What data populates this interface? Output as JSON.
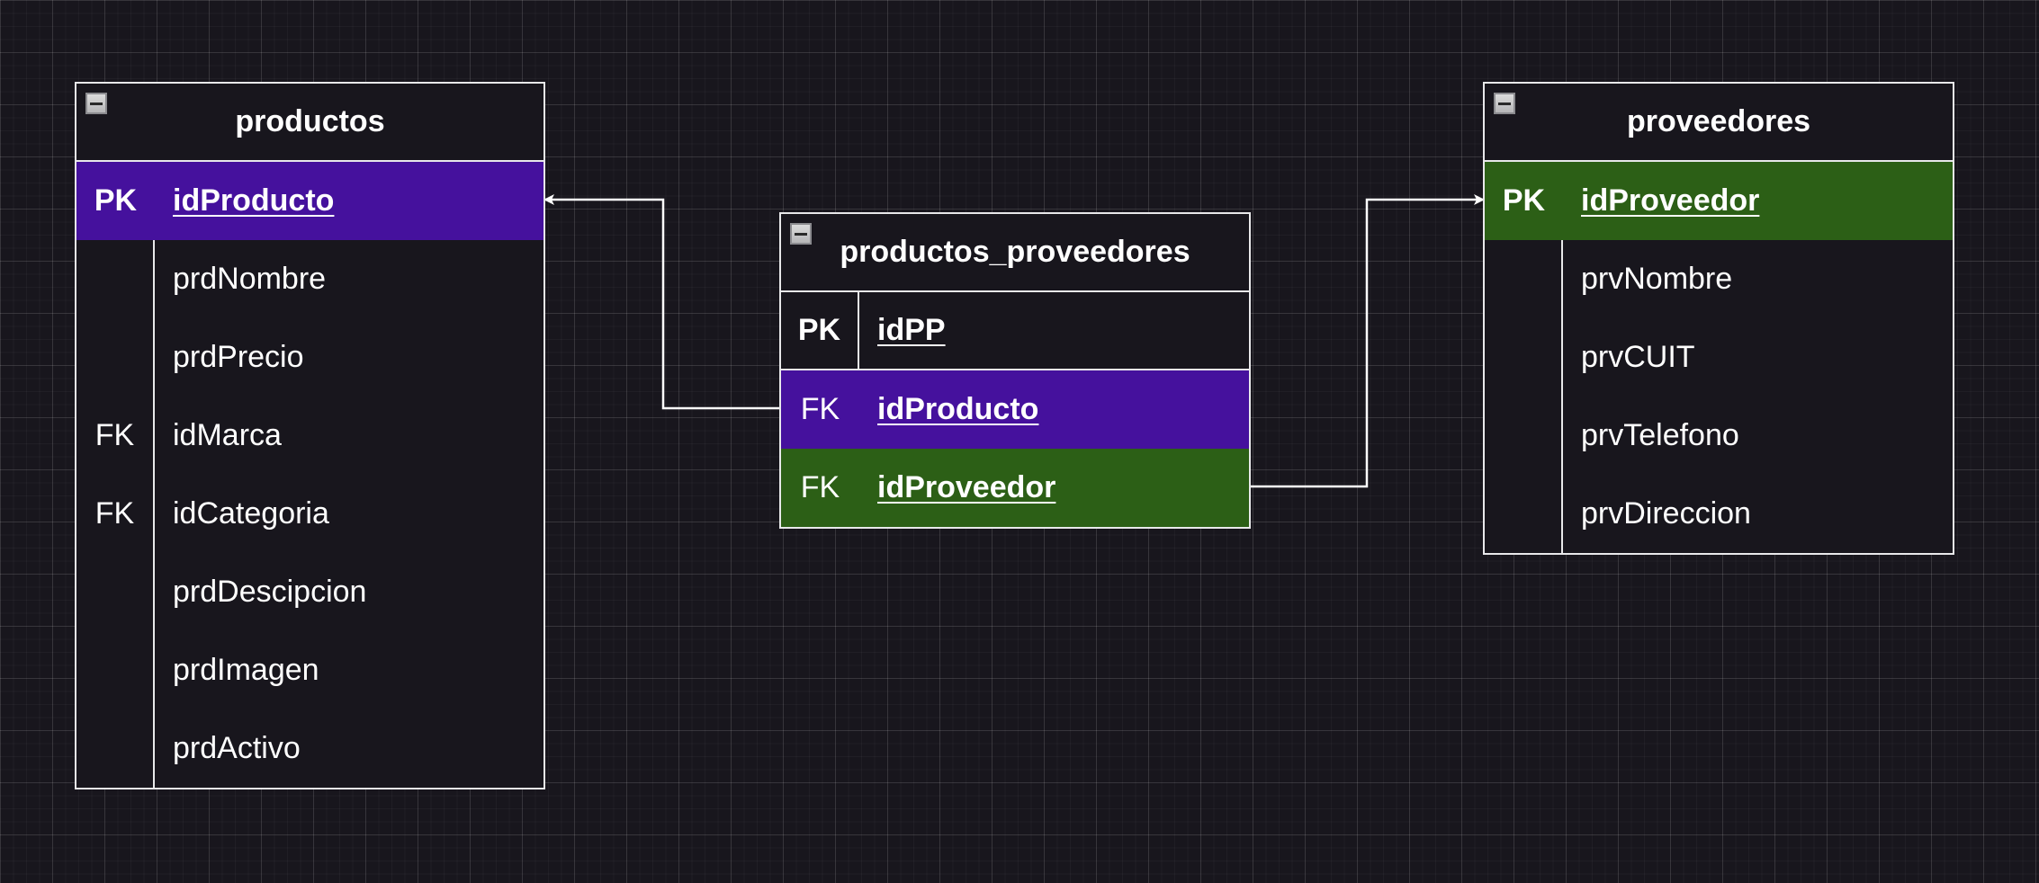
{
  "diagram": {
    "tables": [
      {
        "name": "productos",
        "rows": [
          {
            "key": "PK",
            "field": "idProducto"
          },
          {
            "key": "",
            "field": "prdNombre"
          },
          {
            "key": "",
            "field": "prdPrecio"
          },
          {
            "key": "FK",
            "field": "idMarca"
          },
          {
            "key": "FK",
            "field": "idCategoria"
          },
          {
            "key": "",
            "field": "prdDescipcion"
          },
          {
            "key": "",
            "field": "prdImagen"
          },
          {
            "key": "",
            "field": "prdActivo"
          }
        ]
      },
      {
        "name": "productos_proveedores",
        "rows": [
          {
            "key": "PK",
            "field": "idPP"
          },
          {
            "key": "FK",
            "field": "idProducto"
          },
          {
            "key": "FK",
            "field": "idProveedor"
          }
        ]
      },
      {
        "name": "proveedores",
        "rows": [
          {
            "key": "PK",
            "field": "idProveedor"
          },
          {
            "key": "",
            "field": "prvNombre"
          },
          {
            "key": "",
            "field": "prvCUIT"
          },
          {
            "key": "",
            "field": "prvTelefono"
          },
          {
            "key": "",
            "field": "prvDireccion"
          }
        ]
      }
    ],
    "relations": [
      {
        "from": "productos_proveedores.idProducto",
        "to": "productos.idProducto"
      },
      {
        "from": "productos_proveedores.idProveedor",
        "to": "proveedores.idProveedor"
      }
    ],
    "colors": {
      "background": "#18161d",
      "border": "#e8e8ea",
      "producto_highlight": "#45119d",
      "proveedor_highlight": "#2c5f16",
      "text": "#ffffff"
    }
  }
}
